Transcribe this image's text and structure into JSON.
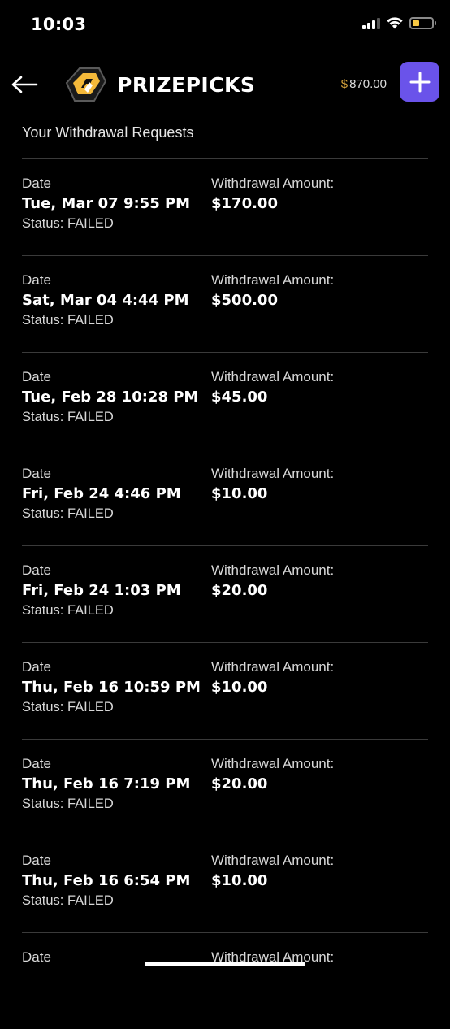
{
  "status_bar": {
    "time": "10:03"
  },
  "header": {
    "brand": "PRIZEPICKS",
    "balance_currency": "$",
    "balance_amount": "870.00",
    "add_label": "+",
    "accent_color": "#6a53ea"
  },
  "section": {
    "title": "Your Withdrawal Requests"
  },
  "labels": {
    "date": "Date",
    "amount": "Withdrawal Amount:"
  },
  "withdrawals": [
    {
      "date": "Tue, Mar 07 9:55 PM",
      "amount": "$170.00",
      "status": "Status: FAILED"
    },
    {
      "date": "Sat, Mar 04 4:44 PM",
      "amount": "$500.00",
      "status": "Status: FAILED"
    },
    {
      "date": "Tue, Feb 28 10:28 PM",
      "amount": "$45.00",
      "status": "Status: FAILED"
    },
    {
      "date": "Fri, Feb 24 4:46 PM",
      "amount": "$10.00",
      "status": "Status: FAILED"
    },
    {
      "date": "Fri, Feb 24 1:03 PM",
      "amount": "$20.00",
      "status": "Status: FAILED"
    },
    {
      "date": "Thu, Feb 16 10:59 PM",
      "amount": "$10.00",
      "status": "Status: FAILED"
    },
    {
      "date": "Thu, Feb 16 7:19 PM",
      "amount": "$20.00",
      "status": "Status: FAILED"
    },
    {
      "date": "Thu, Feb 16 6:54 PM",
      "amount": "$10.00",
      "status": "Status: FAILED"
    }
  ]
}
